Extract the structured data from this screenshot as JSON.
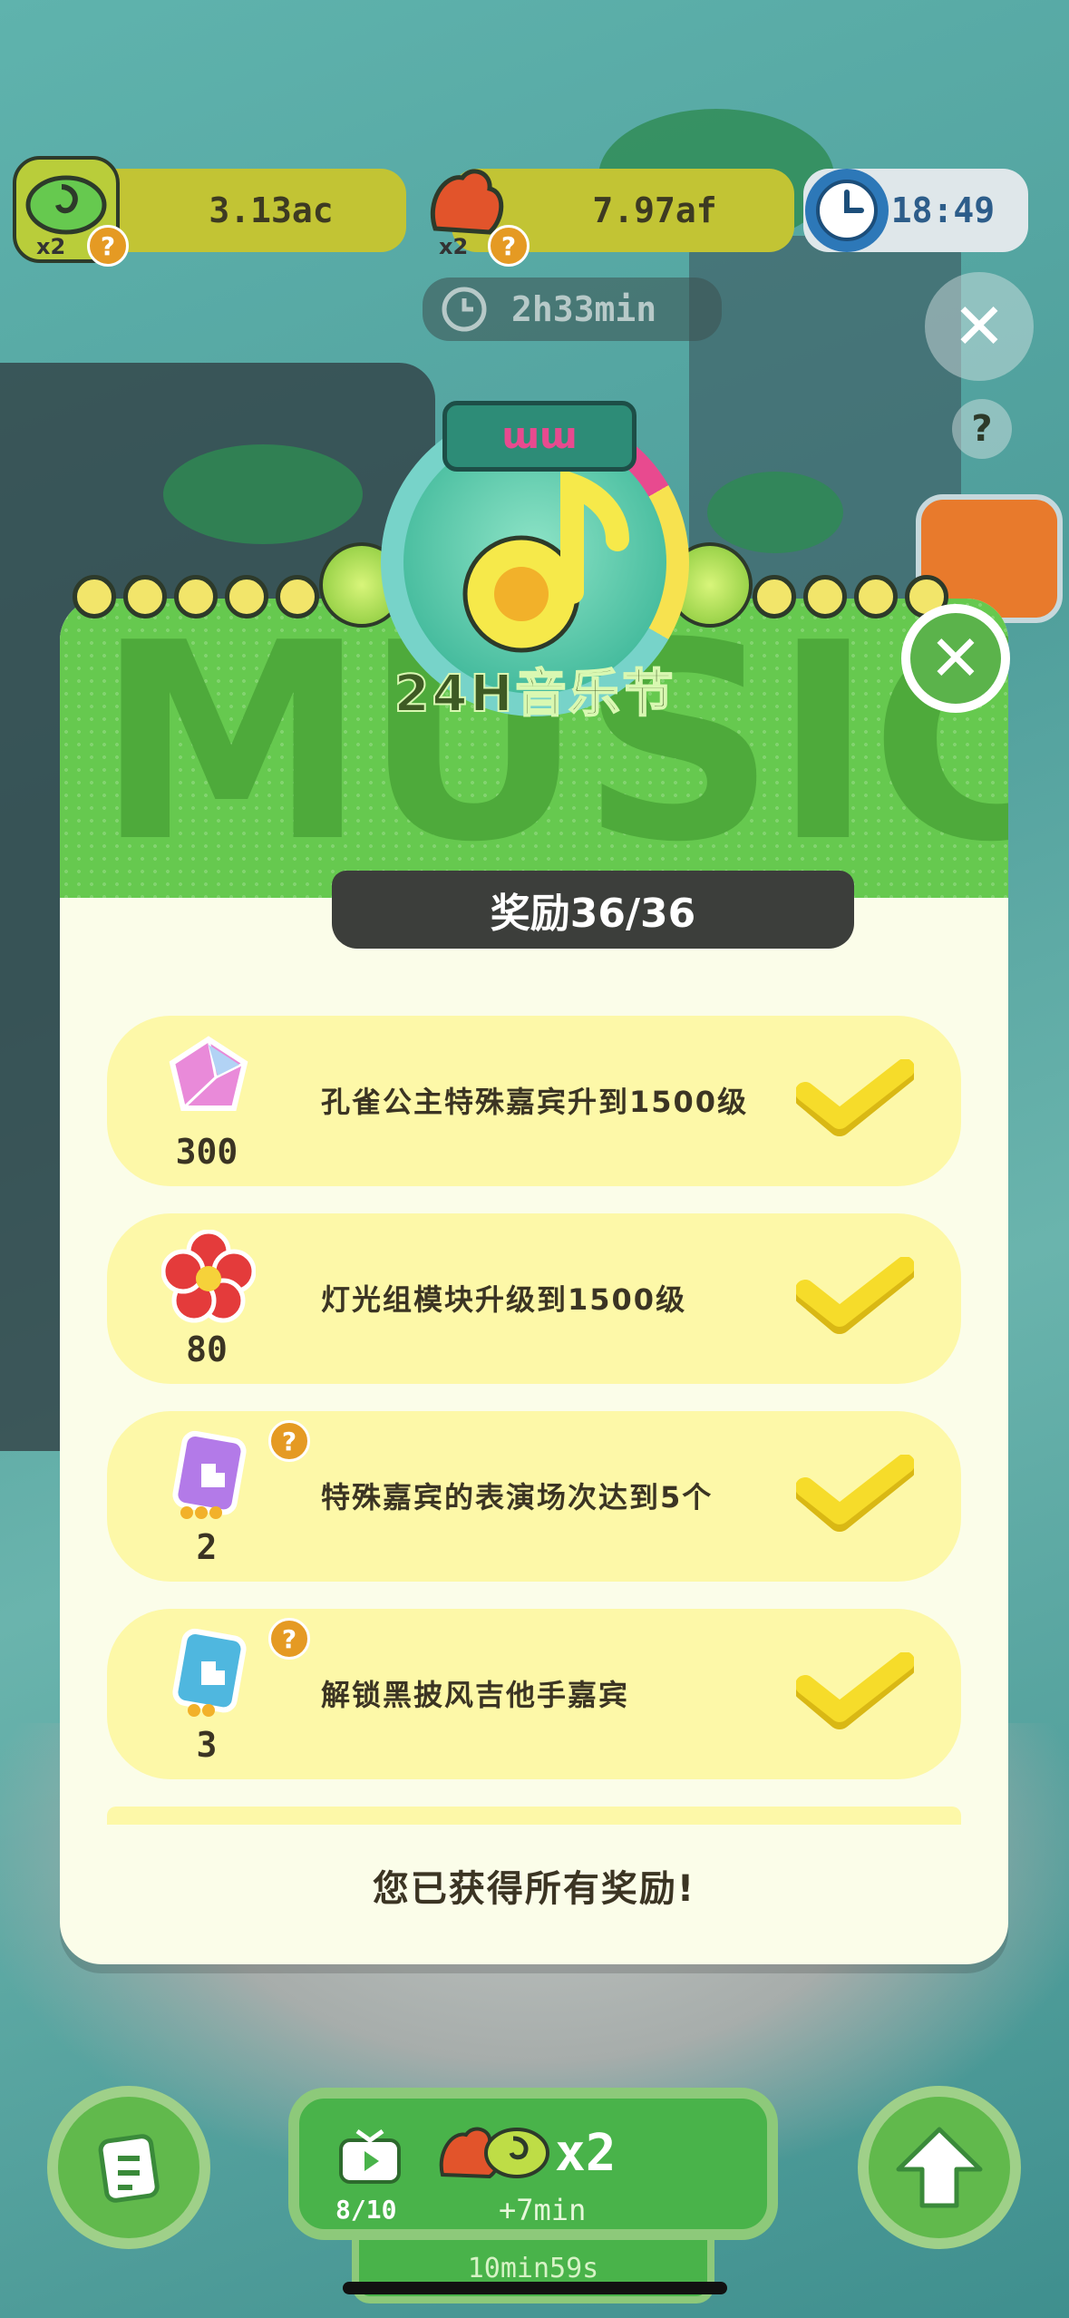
{
  "hud": {
    "resource1": {
      "value": "3.13ac",
      "multiplier": "x2",
      "icon": "music-note-coin-icon"
    },
    "resource2": {
      "value": "7.97af",
      "multiplier": "x2",
      "icon": "red-hand-icon"
    },
    "clock": {
      "value": "18:49"
    },
    "event_timer": "2h33min",
    "help_mark": "?"
  },
  "event": {
    "emblem_tag": "ɯɯ",
    "title": "24H音乐节",
    "banner_text": "MUSIC F"
  },
  "rewards": {
    "header": "奖励36/36",
    "items": [
      {
        "icon": "pink-gem-icon",
        "qty": "300",
        "text": "孔雀公主特殊嘉宾升到1500级",
        "done": true
      },
      {
        "icon": "red-flower-icon",
        "qty": "80",
        "text": "灯光组模块升级到1500级",
        "done": true
      },
      {
        "icon": "purple-card-pack-icon",
        "qty": "2",
        "text": "特殊嘉宾的表演场次达到5个",
        "done": true,
        "help": "?"
      },
      {
        "icon": "blue-card-pack-icon",
        "qty": "3",
        "text": "解锁黑披风吉他手嘉宾",
        "done": true,
        "help": "?"
      }
    ],
    "footer": "您已获得所有奖励!"
  },
  "bottom": {
    "ad_count": "8/10",
    "boost_multiplier": "x2",
    "boost_time": "+7min",
    "boost_remaining": "10min59s"
  },
  "colors": {
    "accent_green": "#61b94c",
    "card_yellow": "#fdf8a8",
    "check_yellow": "#f6dc2a"
  }
}
